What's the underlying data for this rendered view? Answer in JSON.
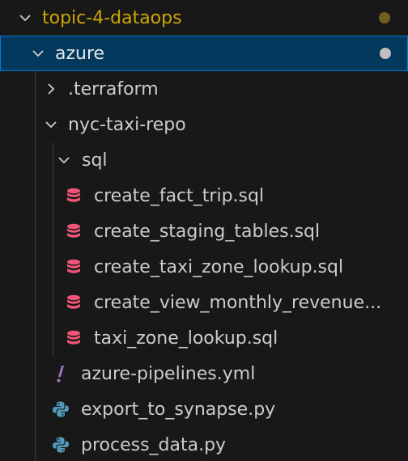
{
  "colors": {
    "background": "#181818",
    "folder_modified": "#cca700",
    "selected_bg": "#04395e",
    "selected_border": "#0078d4",
    "text": "#cccccc",
    "sql_icon": "#f05577",
    "yml_icon": "#a074c4",
    "python_icon": "#519aba",
    "dot_modified": "#6f5f1f",
    "dot_selected": "#bfbfbf"
  },
  "tree": {
    "root": {
      "label": "topic-4-dataops",
      "icon": "chevron-down-icon"
    },
    "azure": {
      "label": "azure",
      "icon": "chevron-down-icon"
    },
    "terraform": {
      "label": ".terraform",
      "icon": "chevron-right-icon"
    },
    "repo": {
      "label": "nyc-taxi-repo",
      "icon": "chevron-down-icon"
    },
    "sql_folder": {
      "label": "sql",
      "icon": "chevron-down-icon"
    },
    "files": [
      {
        "label": "create_fact_trip.sql",
        "icon": "database-icon"
      },
      {
        "label": "create_staging_tables.sql",
        "icon": "database-icon"
      },
      {
        "label": "create_taxi_zone_lookup.sql",
        "icon": "database-icon"
      },
      {
        "label": "create_view_monthly_revenue...",
        "icon": "database-icon"
      },
      {
        "label": "taxi_zone_lookup.sql",
        "icon": "database-icon"
      }
    ],
    "repo_files": [
      {
        "label": "azure-pipelines.yml",
        "icon": "exclamation-icon"
      },
      {
        "label": "export_to_synapse.py",
        "icon": "python-icon"
      },
      {
        "label": "process_data.py",
        "icon": "python-icon"
      }
    ]
  }
}
